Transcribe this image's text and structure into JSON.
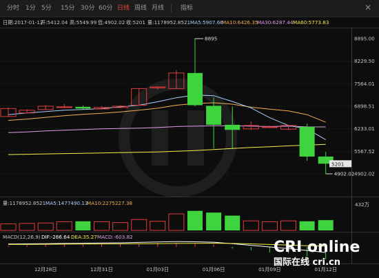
{
  "tabs": [
    {
      "label": "分时",
      "active": false
    },
    {
      "label": "1分",
      "active": false
    },
    {
      "label": "5分",
      "active": false
    },
    {
      "label": "15分",
      "active": false
    },
    {
      "label": "30分",
      "active": false
    },
    {
      "label": "60分",
      "active": false
    },
    {
      "label": "日线",
      "active": true
    },
    {
      "label": "周线",
      "active": false
    },
    {
      "label": "月线",
      "active": false
    }
  ],
  "indicator_tab": "指标",
  "info": {
    "date": "日期:2017-01-12",
    "open": "开:5412.04",
    "high": "高:5549.99",
    "low": "低:4902.02",
    "close": "收:5201",
    "volume": "量:1178952.8521",
    "ma5": "MA5:5907.66",
    "ma10": "MA10:6426.35",
    "ma30": "MA30:6287.44",
    "ma60": "MA60:5773.83"
  },
  "price_axis": [
    "8895.00",
    "8229.50",
    "7564.01",
    "6898.51",
    "6233.01",
    "5567.52",
    "4902.02"
  ],
  "price_tag": "5201",
  "high_marker": "8895",
  "low_marker": "4902.02",
  "volume_info": {
    "volume": "量:1178952.8521",
    "ma5": "MA5:1477490.13",
    "ma10": "MA10:2275227.38"
  },
  "volume_axis": "432万",
  "macd_info": {
    "label": "MACD(12,26,9)",
    "dif": "DIF:-266.64",
    "dea": "DEA:35.27",
    "macd": "MACD:-603.82"
  },
  "date_axis": [
    "12月28日",
    "12月31日",
    "01月03日",
    "01月06日",
    "01月09日",
    "01月12日"
  ],
  "colors": {
    "up": "#e03c3c",
    "down": "#3fd43f",
    "ma5": "#a7d0ff",
    "ma10": "#f0b050",
    "ma30": "#e49cec",
    "ma60": "#f4f045",
    "active_tab": "#e84a3a"
  },
  "watermark": {
    "brand": "CRI online",
    "subtitle": "国际在线 cri.cn"
  },
  "chart_data": {
    "type": "candlestick",
    "dates": [
      "12-26",
      "12-27",
      "12-28",
      "12-29",
      "12-30",
      "12-31",
      "01-01",
      "01-02",
      "01-03",
      "01-04",
      "01-05",
      "01-06",
      "01-07",
      "01-08",
      "01-09",
      "01-10",
      "01-11",
      "01-12"
    ],
    "candles": [
      {
        "o": 6595,
        "c": 6830,
        "h": 6860,
        "l": 6580
      },
      {
        "o": 6700,
        "c": 6780,
        "h": 6810,
        "l": 6690
      },
      {
        "o": 6800,
        "c": 6900,
        "h": 6930,
        "l": 6790
      },
      {
        "o": 6860,
        "c": 6880,
        "h": 6960,
        "l": 6840
      },
      {
        "o": 6880,
        "c": 6830,
        "h": 6920,
        "l": 6810
      },
      {
        "o": 6820,
        "c": 6860,
        "h": 6900,
        "l": 6800
      },
      {
        "o": 6860,
        "c": 6900,
        "h": 6930,
        "l": 6840
      },
      {
        "o": 6930,
        "c": 7420,
        "h": 7430,
        "l": 6920
      },
      {
        "o": 7440,
        "c": 7470,
        "h": 7480,
        "l": 7390
      },
      {
        "o": 7420,
        "c": 7880,
        "h": 7960,
        "l": 7410
      },
      {
        "o": 7880,
        "c": 6930,
        "h": 8895,
        "l": 6890
      },
      {
        "o": 6910,
        "c": 6350,
        "h": 7160,
        "l": 5650
      },
      {
        "o": 6350,
        "c": 6200,
        "h": 6890,
        "l": 5660
      },
      {
        "o": 6230,
        "c": 6330,
        "h": 6450,
        "l": 6200
      },
      {
        "o": 6270,
        "c": 6290,
        "h": 6330,
        "l": 6250
      },
      {
        "o": 6220,
        "c": 6330,
        "h": 6350,
        "l": 6200
      },
      {
        "o": 6290,
        "c": 5412,
        "h": 6380,
        "l": 5290
      },
      {
        "o": 5412,
        "c": 5201,
        "h": 5550,
        "l": 4902.02
      }
    ],
    "ma5": [
      6650,
      6700,
      6740,
      6780,
      6800,
      6830,
      6880,
      6930,
      7030,
      7150,
      7230,
      7210,
      7040,
      6850,
      6560,
      6330,
      6230,
      5907.66
    ],
    "ma10": [
      6480,
      6520,
      6570,
      6620,
      6660,
      6690,
      6730,
      6780,
      6840,
      6930,
      6980,
      7000,
      6960,
      6870,
      6810,
      6760,
      6650,
      6426.35
    ],
    "ma30": [
      6120,
      6140,
      6170,
      6190,
      6210,
      6230,
      6240,
      6250,
      6270,
      6300,
      6310,
      6320,
      6320,
      6310,
      6300,
      6310,
      6290,
      6287.44
    ],
    "ma60": [
      5470,
      5480,
      5490,
      5500,
      5510,
      5520,
      5530,
      5540,
      5550,
      5570,
      5590,
      5620,
      5650,
      5680,
      5700,
      5730,
      5750,
      5773.83
    ],
    "volume": [
      750000,
      800000,
      850000,
      1000000,
      1050000,
      1000000,
      900000,
      1250000,
      1050000,
      1900000,
      2250000,
      2050000,
      1700000,
      1100000,
      1000000,
      1100000,
      1050000,
      1178952.8521
    ],
    "macd_hist": [
      60,
      90,
      120,
      140,
      150,
      160,
      170,
      180,
      200,
      210,
      190,
      120,
      -80,
      -160,
      -260,
      -300,
      -450,
      -603.82
    ],
    "dif": [
      140,
      150,
      160,
      170,
      180,
      190,
      200,
      220,
      240,
      260,
      250,
      230,
      160,
      80,
      0,
      -80,
      -170,
      -266.64
    ],
    "dea": [
      120,
      125,
      130,
      135,
      140,
      145,
      150,
      155,
      160,
      170,
      175,
      180,
      170,
      150,
      120,
      90,
      60,
      35.27
    ],
    "ylim": [
      4902.02,
      8895
    ],
    "volume_max": 4320000
  }
}
